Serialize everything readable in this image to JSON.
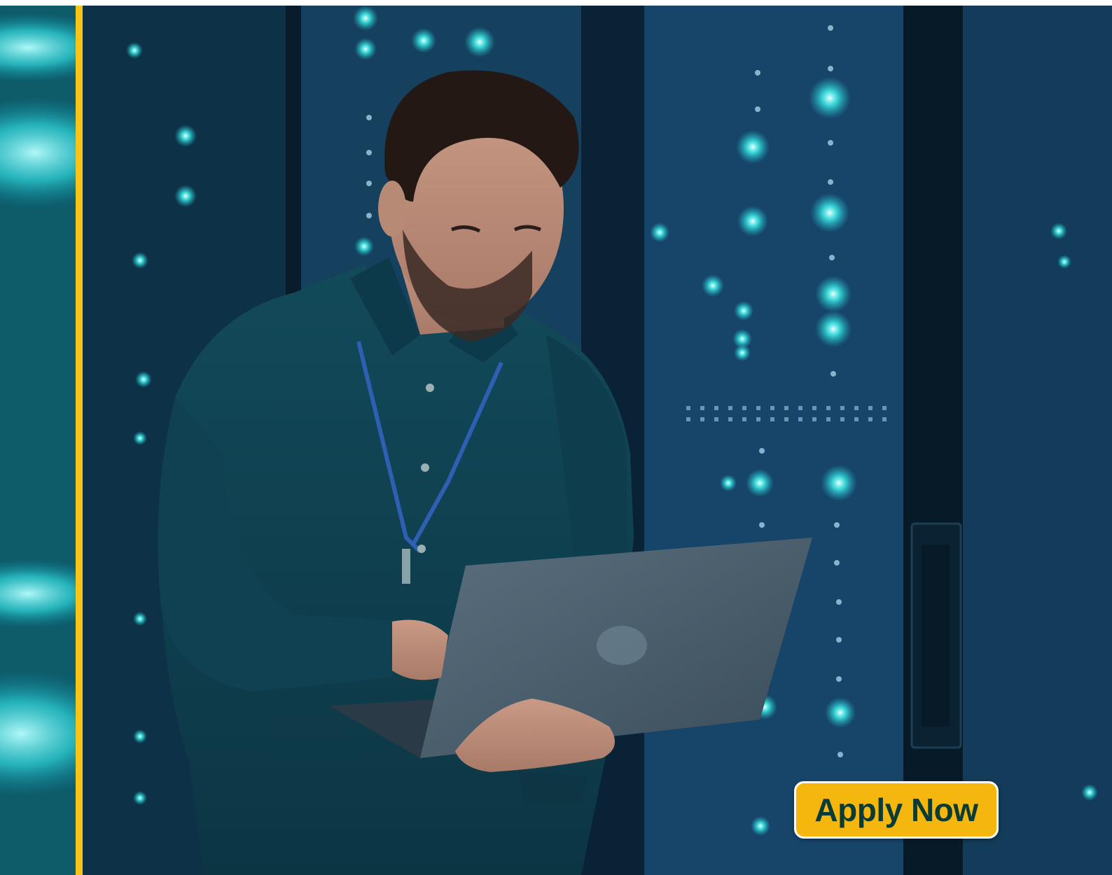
{
  "hero": {
    "image_description_icon": "engineer-with-laptop-in-server-room",
    "accent_color": "#f5c518"
  },
  "cta": {
    "label": "Apply Now",
    "background_color": "#f5b70e",
    "text_color": "#0b3b35"
  }
}
